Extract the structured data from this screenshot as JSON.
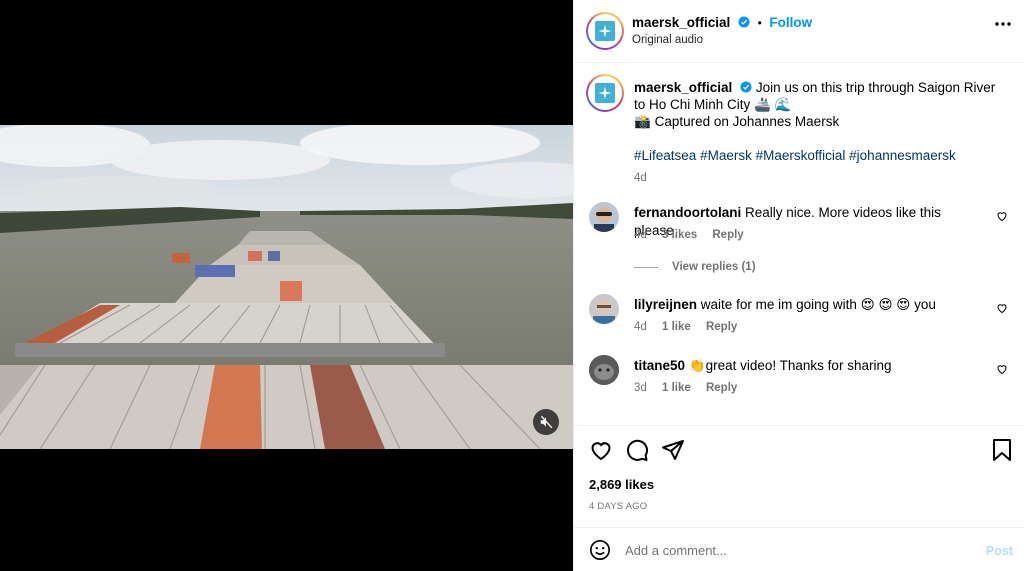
{
  "header": {
    "username": "maersk_official",
    "separator": "•",
    "follow_label": "Follow",
    "audio_label": "Original audio"
  },
  "caption": {
    "username": "maersk_official",
    "text_line1": "Join us on this trip through Saigon River to Ho Chi Minh City",
    "emoji1": "🚢 🌊",
    "camera_emoji": "📸",
    "captured": "Captured on Johannes Maersk",
    "hashtags": [
      "#Lifeatsea",
      "#Maersk",
      "#Maerskofficial",
      "#johannesmaersk"
    ],
    "time": "4d"
  },
  "comments": [
    {
      "username": "fernandoortolani",
      "text": "Really nice. More videos like this please",
      "time": "4d",
      "likes": "3 likes",
      "reply": "Reply"
    },
    {
      "username": "lilyreijnen",
      "text": "waite for me im going with",
      "emojis": "😍 😍 😍",
      "text_after": "you",
      "time": "4d",
      "likes": "1 like",
      "reply": "Reply"
    },
    {
      "username": "titane50",
      "emoji": "👏",
      "text": "great video! Thanks for sharing",
      "time": "3d",
      "likes": "1 like",
      "reply": "Reply"
    }
  ],
  "view_replies": "View replies (1)",
  "likes_count": "2,869 likes",
  "post_date": "4 DAYS AGO",
  "add_comment": {
    "placeholder": "Add a comment...",
    "post_label": "Post"
  },
  "colors": {
    "accent": "#0095f6",
    "link": "#00376b",
    "muted": "#737373",
    "maersk_blue": "#42b0d5"
  },
  "icons": [
    "more-icon",
    "heart-icon",
    "comment-icon",
    "share-icon",
    "save-icon",
    "emoji-icon",
    "mute-icon",
    "verified-icon"
  ]
}
